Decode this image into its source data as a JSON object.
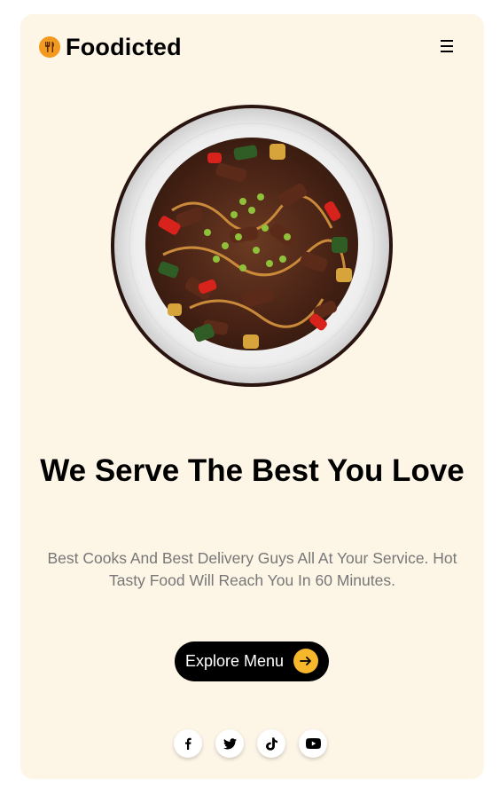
{
  "brand": {
    "name": "Foodicted",
    "logo_icon": "utensils-icon",
    "accent": "#f39a1e"
  },
  "nav": {
    "menu_icon": "hamburger-icon"
  },
  "hero": {
    "image_alt": "plate-of-beef-stir-fry",
    "headline": "We Serve The Best You Love",
    "description": "Best Cooks And Best Delivery Guys All At Your Service. Hot Tasty Food Will Reach You In 60 Minutes.",
    "cta_label": "Explore Menu",
    "cta_icon": "arrow-right-icon"
  },
  "socials": [
    {
      "icon": "facebook-icon"
    },
    {
      "icon": "twitter-icon"
    },
    {
      "icon": "tiktok-icon"
    },
    {
      "icon": "youtube-icon"
    }
  ],
  "colors": {
    "card_bg": "#fdf5e6",
    "button_bg": "#000000",
    "arrow_bg": "#f7b72b",
    "text_muted": "#777777"
  }
}
